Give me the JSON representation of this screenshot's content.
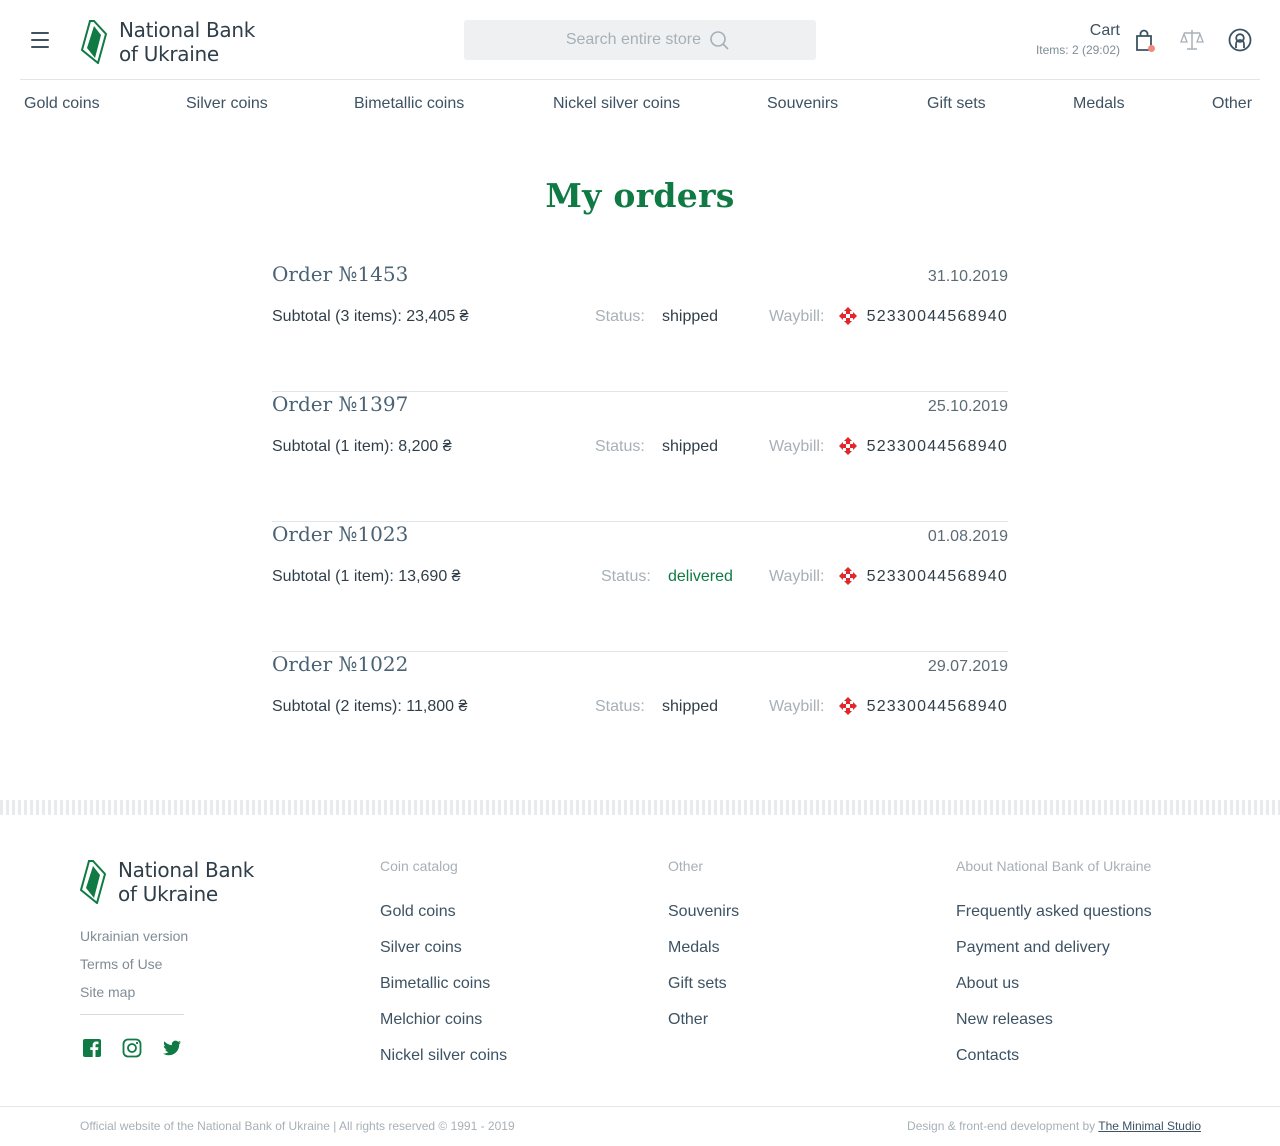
{
  "header": {
    "logo_line1": "National Bank",
    "logo_line2": "of Ukraine",
    "search_placeholder": "Search entire store",
    "cart_label": "Cart",
    "cart_items": "Items: 2 (29:02)",
    "icons": [
      "menu-icon",
      "search-icon",
      "cart-icon",
      "compare-icon",
      "user-icon"
    ]
  },
  "nav": {
    "items": [
      "Gold coins",
      "Silver coins",
      "Bimetallic coins",
      "Nickel silver coins",
      "Souvenirs",
      "Gift sets",
      "Medals",
      "Other"
    ]
  },
  "page": {
    "title": "My orders"
  },
  "labels": {
    "status": "Status:",
    "waybill": "Waybill:"
  },
  "orders": [
    {
      "title": "Order №1453",
      "date": "31.10.2019",
      "subtotal": "Subtotal (3 items): 23,405 ₴",
      "status": "shipped",
      "waybill": "52330044568940"
    },
    {
      "title": "Order №1397",
      "date": "25.10.2019",
      "subtotal": "Subtotal (1 item): 8,200 ₴",
      "status": "shipped",
      "waybill": "52330044568940"
    },
    {
      "title": "Order №1023",
      "date": "01.08.2019",
      "subtotal": "Subtotal (1 item): 13,690 ₴",
      "status": "delivered",
      "waybill": "52330044568940"
    },
    {
      "title": "Order №1022",
      "date": "29.07.2019",
      "subtotal": "Subtotal (2 items): 11,800 ₴",
      "status": "shipped",
      "waybill": "52330044568940"
    }
  ],
  "footer": {
    "logo_line1": "National Bank",
    "logo_line2": "of Ukraine",
    "links": [
      "Ukrainian version",
      "Terms of Use",
      "Site map"
    ],
    "social": [
      "facebook-icon",
      "instagram-icon",
      "twitter-icon"
    ],
    "columns": [
      {
        "title": "Coin catalog",
        "items": [
          "Gold coins",
          "Silver coins",
          "Bimetallic coins",
          "Melchior coins",
          "Nickel silver coins"
        ]
      },
      {
        "title": "Other",
        "items": [
          "Souvenirs",
          "Medals",
          "Gift sets",
          "Other"
        ]
      },
      {
        "title": "About National Bank of Ukraine",
        "items": [
          "Frequently asked questions",
          "Payment and delivery",
          "About us",
          "New releases",
          "Contacts"
        ]
      }
    ],
    "copyright": "Official website of the National Bank of Ukraine | All rights reserved © 1991 - 2019",
    "credits_prefix": "Design & front-end development by ",
    "credits_link": "The Minimal Studio"
  },
  "colors": {
    "brand_green": "#0f7a44",
    "text_dark": "#2f3e48",
    "muted": "#a7b0b7",
    "nova_poshta_red": "#e2262c",
    "cart_badge": "#f28a7a"
  }
}
